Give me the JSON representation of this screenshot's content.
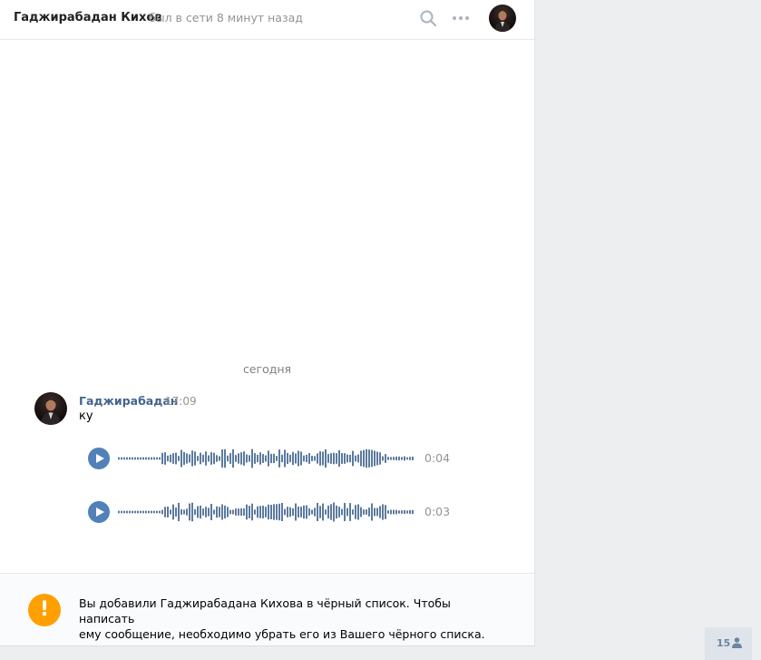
{
  "header": {
    "contact_name": "Гаджирабадан Кихов",
    "status": "был в сети 8 минут назад",
    "icons": [
      "search-icon",
      "more-icon"
    ]
  },
  "conversation": {
    "date_divider": "сегодня",
    "message": {
      "author": "Гаджирабадан",
      "time": "17:09",
      "text": "ку",
      "voice_messages": [
        {
          "duration": "0:04"
        },
        {
          "duration": "0:03"
        }
      ]
    }
  },
  "blacklist_notice": {
    "icon": "warning-icon",
    "text_line1": "Вы добавили Гаджирабадана Кихова в чёрный список. Чтобы написать",
    "text_line2": "ему сообщение, необходимо убрать его из Вашего чёрного списка."
  },
  "online_counter": {
    "value": "15",
    "icon": "person-icon"
  },
  "colors": {
    "accent": "#5181b8",
    "link": "#42648b",
    "warning": "#ffa000",
    "muted": "#939393",
    "background": "#edeef0"
  }
}
